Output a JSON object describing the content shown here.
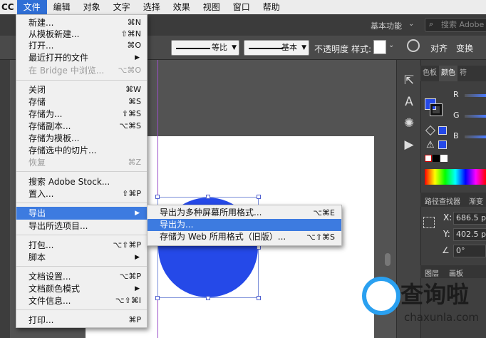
{
  "menubar": {
    "app": "CC",
    "items": [
      "文件",
      "编辑",
      "对象",
      "文字",
      "选择",
      "效果",
      "视图",
      "窗口",
      "帮助"
    ],
    "active": "文件"
  },
  "appbar": {
    "workspace": "基本功能",
    "search_placeholder": "搜索 Adobe"
  },
  "controlbar": {
    "stroke_label": "等比",
    "profile_label": "基本",
    "opacity_label": "不透明度",
    "style_label": "样式:",
    "align": "对齐",
    "transform": "变换"
  },
  "file_menu": [
    {
      "label": "新建...",
      "shortcut": "⌘N"
    },
    {
      "label": "从模板新建...",
      "shortcut": "⇧⌘N"
    },
    {
      "label": "打开...",
      "shortcut": "⌘O"
    },
    {
      "label": "最近打开的文件",
      "arrow": "▶"
    },
    {
      "label": "在 Bridge 中浏览...",
      "shortcut": "⌥⌘O",
      "disabled": true
    },
    {
      "label": "关闭",
      "shortcut": "⌘W"
    },
    {
      "label": "存储",
      "shortcut": "⌘S"
    },
    {
      "label": "存储为...",
      "shortcut": "⇧⌘S"
    },
    {
      "label": "存储副本...",
      "shortcut": "⌥⌘S"
    },
    {
      "label": "存储为模板..."
    },
    {
      "label": "存储选中的切片..."
    },
    {
      "label": "恢复",
      "shortcut": "⌘Z",
      "disabled": true
    },
    {
      "label": "搜索 Adobe Stock..."
    },
    {
      "label": "置入...",
      "shortcut": "⇧⌘P"
    },
    {
      "label": "导出",
      "arrow": "▶",
      "highlighted": true
    },
    {
      "label": "导出所选项目..."
    },
    {
      "label": "打包...",
      "shortcut": "⌥⇧⌘P"
    },
    {
      "label": "脚本",
      "arrow": "▶"
    },
    {
      "label": "文档设置...",
      "shortcut": "⌥⌘P"
    },
    {
      "label": "文档颜色模式",
      "arrow": "▶"
    },
    {
      "label": "文件信息...",
      "shortcut": "⌥⇧⌘I"
    },
    {
      "label": "打印...",
      "shortcut": "⌘P"
    }
  ],
  "export_submenu": [
    {
      "label": "导出为多种屏幕所用格式...",
      "shortcut": "⌥⌘E"
    },
    {
      "label": "导出为...",
      "highlighted": true
    },
    {
      "label": "存储为 Web 所用格式（旧版）...",
      "shortcut": "⌥⇧⌘S"
    }
  ],
  "right_panel": {
    "tabs": [
      "色板",
      "颜色",
      "符"
    ],
    "active_tab": "颜色",
    "channels": [
      "R",
      "G",
      "B"
    ],
    "pathfinder_tabs": [
      "路径查找器",
      "渐变"
    ],
    "x_label": "X:",
    "x_value": "686.5 px",
    "y_label": "Y:",
    "y_value": "402.5 px",
    "angle_value": "0°",
    "layers_tabs": [
      "图层",
      "画板"
    ]
  },
  "colors": {
    "shape_fill": "#2549e8",
    "guide": "#9b4fc9",
    "menu_highlight": "#3d7be0"
  },
  "watermark": {
    "text": "查询啦",
    "url": "chaxunla.com"
  }
}
